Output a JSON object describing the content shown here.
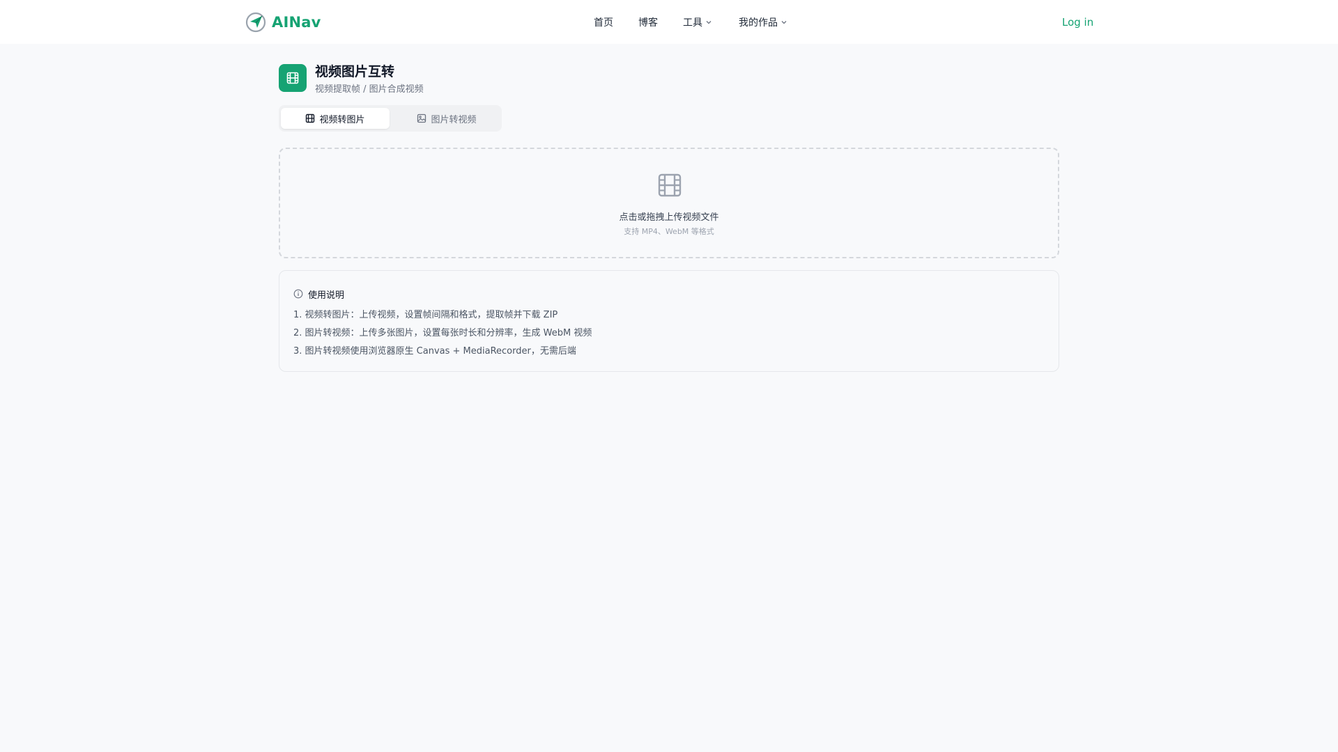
{
  "header": {
    "brand": "AINav",
    "nav": [
      {
        "label": "首页",
        "dropdown": false
      },
      {
        "label": "博客",
        "dropdown": false
      },
      {
        "label": "工具",
        "dropdown": true
      },
      {
        "label": "我的作品",
        "dropdown": true
      }
    ],
    "login": "Log in"
  },
  "page": {
    "title": "视频图片互转",
    "subtitle": "视频提取帧 / 图片合成视频",
    "icon": "film-icon"
  },
  "tabs": [
    {
      "label": "视频转图片",
      "icon": "film-icon",
      "active": true
    },
    {
      "label": "图片转视频",
      "icon": "image-icon",
      "active": false
    }
  ],
  "upload": {
    "icon": "film-icon",
    "text": "点击或拖拽上传视频文件",
    "hint": "支持 MP4、WebM 等格式"
  },
  "instructions": {
    "title": "使用说明",
    "icon": "info-icon",
    "items": [
      "1. 视频转图片：上传视频，设置帧间隔和格式，提取帧并下载 ZIP",
      "2. 图片转视频：上传多张图片，设置每张时长和分辨率，生成 WebM 视频",
      "3. 图片转视频使用浏览器原生 Canvas + MediaRecorder，无需后端"
    ]
  },
  "colors": {
    "accent": "#16a373",
    "background": "#f8f9fb",
    "text": "#1f2937",
    "muted": "#6b7280"
  }
}
